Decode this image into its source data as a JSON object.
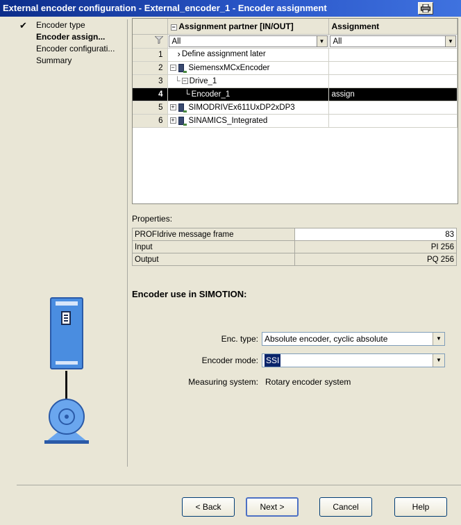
{
  "window": {
    "title": "External encoder configuration - External_encoder_1 - Encoder assignment"
  },
  "nav": {
    "items": [
      {
        "label": "Encoder type",
        "done": true,
        "active": false
      },
      {
        "label": "Encoder assign...",
        "done": false,
        "active": true
      },
      {
        "label": "Encoder configurati...",
        "done": false,
        "active": false
      },
      {
        "label": "Summary",
        "done": false,
        "active": false
      }
    ]
  },
  "grid": {
    "columns": {
      "partner": "Assignment partner [IN/OUT]",
      "assignment": "Assignment"
    },
    "filter": {
      "partner": "All",
      "assignment": "All"
    },
    "rows": [
      {
        "num": "1",
        "name": "Define assignment later",
        "assign": ""
      },
      {
        "num": "2",
        "name": "SiemensxMCxEncoder",
        "assign": ""
      },
      {
        "num": "3",
        "name": "Drive_1",
        "assign": ""
      },
      {
        "num": "4",
        "name": "Encoder_1",
        "assign": "assign"
      },
      {
        "num": "5",
        "name": "SIMODRIVEx611UxDP2xDP3",
        "assign": ""
      },
      {
        "num": "6",
        "name": "SINAMICS_Integrated",
        "assign": ""
      }
    ]
  },
  "properties": {
    "label": "Properties:",
    "rows": [
      {
        "name": "PROFIdrive message frame",
        "value": "83"
      },
      {
        "name": "Input",
        "value": "PI 256"
      },
      {
        "name": "Output",
        "value": "PQ 256"
      }
    ]
  },
  "encoder_use": {
    "title": "Encoder use in SIMOTION:",
    "enc_type_label": "Enc. type:",
    "enc_type_value": "Absolute encoder, cyclic absolute",
    "enc_mode_label": "Encoder mode:",
    "enc_mode_value": "SSI",
    "measuring_label": "Measuring system:",
    "measuring_value": "Rotary encoder system"
  },
  "buttons": {
    "back": "< Back",
    "next": "Next >",
    "cancel": "Cancel",
    "help": "Help"
  }
}
